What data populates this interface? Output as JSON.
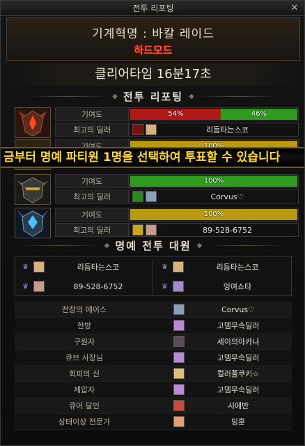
{
  "window": {
    "title": "전투 리포팅",
    "close_glyph": "✕"
  },
  "header": {
    "raid_name": "기계혁명 : 바칼 레이드",
    "mode": "하드모드"
  },
  "clear_time": "클리어타임 16분17초",
  "sections": {
    "battle_report": "전투 리포팅",
    "honor_party": "명예 전투 대원"
  },
  "labels": {
    "contribution": "기여도",
    "best_dealer": "최고의 딜러"
  },
  "banner_text": "금부터 명예 파티원 1명을 선택하여 투표할 수 있습니다",
  "players": [
    {
      "avatar_icon": "red-horned-helmet-icon",
      "bar": [
        {
          "pct": 54,
          "label": "54%",
          "color": "#b01818"
        },
        {
          "pct": 46,
          "label": "46%",
          "color": "#2f9a1f"
        }
      ],
      "dealer_icon": "red-slash-skill-icon",
      "dealer_name": "리듬타는스코"
    },
    {
      "avatar_icon": "gold-helmet-icon",
      "bar": [
        {
          "pct": 100,
          "label": "100%",
          "color": "#b89a12"
        }
      ],
      "dealer_icon": "gold-skill-icon",
      "dealer_name": ""
    },
    {
      "avatar_icon": "dark-armor-helmet-icon",
      "bar": [
        {
          "pct": 100,
          "label": "100%",
          "color": "#2f9a1f"
        }
      ],
      "dealer_icon": "green-skill-icon",
      "dealer_name": "Corvus♡"
    },
    {
      "avatar_icon": "blue-crystal-helmet-icon",
      "bar": [
        {
          "pct": 100,
          "label": "100%",
          "color": "#b89a12"
        }
      ],
      "dealer_icon": "gold-blade-skill-icon",
      "dealer_name": "89-528-6752"
    }
  ],
  "honor_members": [
    {
      "name": "리듬타는스코"
    },
    {
      "name": "리듬타는스코"
    },
    {
      "name": "89-528-6752"
    },
    {
      "name": "잉여쇼타"
    }
  ],
  "awards": [
    {
      "title": "전장의 에이스",
      "player": "Corvus♡"
    },
    {
      "title": "한방",
      "player": "고뎀무속딜러"
    },
    {
      "title": "구원자",
      "player": "세이의아카나"
    },
    {
      "title": "큐브 사장님",
      "player": "고뎀무속딜러"
    },
    {
      "title": "회피의 신",
      "player": "컬러풀쿠키☆"
    },
    {
      "title": "제압자",
      "player": "고뎀무속딜러"
    },
    {
      "title": "큐어 달인",
      "player": "시에반"
    },
    {
      "title": "상태이상 전문가",
      "player": "밍훈"
    }
  ],
  "colors": {
    "mode_red": "#ff5a3c",
    "banner_yellow": "#ffd92a",
    "bar_red": "#b01818",
    "bar_green": "#2f9a1f",
    "bar_gold": "#b89a12"
  }
}
